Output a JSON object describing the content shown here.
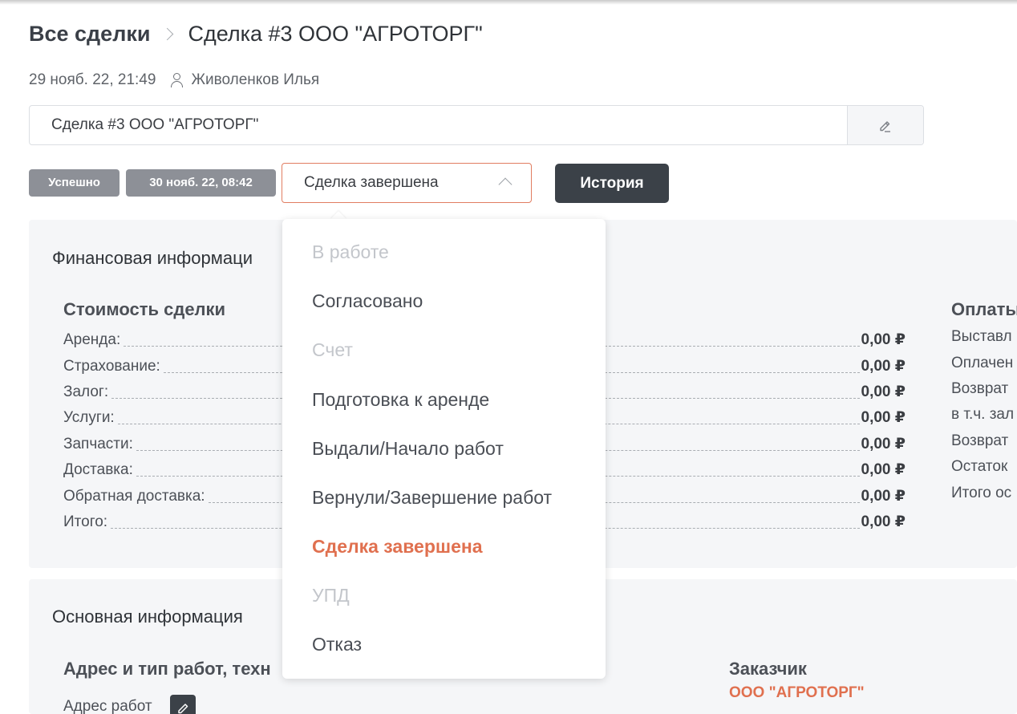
{
  "breadcrumb": {
    "root": "Все сделки",
    "current": "Сделка #3 ООО \"АГРОТОРГ\""
  },
  "meta": {
    "datetime": "29 нояб. 22, 21:49",
    "author": "Живоленков Илья"
  },
  "title_input": {
    "value": "Сделка #3 ООО \"АГРОТОРГ\""
  },
  "badges": {
    "status": "Успешно",
    "date": "30 нояб. 22, 08:42"
  },
  "status_select": {
    "value": "Сделка завершена"
  },
  "history_button": "История",
  "financial": {
    "title": "Финансовая информаци",
    "cost": {
      "heading": "Стоимость сделки",
      "rows": [
        {
          "label": "Аренда:",
          "value": "0,00 ₽"
        },
        {
          "label": "Страхование:",
          "value": "0,00 ₽"
        },
        {
          "label": "Залог:",
          "value": "0,00 ₽"
        },
        {
          "label": "Услуги:",
          "value": "0,00 ₽"
        },
        {
          "label": "Запчасти:",
          "value": "0,00 ₽"
        },
        {
          "label": "Доставка:",
          "value": "0,00 ₽"
        },
        {
          "label": "Обратная доставка:",
          "value": "0,00 ₽"
        },
        {
          "label": "Итого:",
          "value": "0,00 ₽"
        }
      ]
    },
    "payments": {
      "heading": "Оплаты",
      "rows": [
        "Выставл",
        "Оплачен",
        "Возврат",
        "в т.ч. зал",
        "Возврат",
        "Остаток",
        "Итого ос"
      ]
    }
  },
  "main_info": {
    "title": "Основная информация",
    "address_heading": "Адрес и тип работ, техн",
    "address_label": "Адрес работ",
    "customer_heading": "Заказчик",
    "customer_name": "ООО \"АГРОТОРГ\""
  },
  "dropdown": {
    "items": [
      {
        "label": "В работе",
        "state": "disabled"
      },
      {
        "label": "Согласовано",
        "state": "normal"
      },
      {
        "label": "Счет",
        "state": "disabled"
      },
      {
        "label": "Подготовка к аренде",
        "state": "normal"
      },
      {
        "label": "Выдали/Начало работ",
        "state": "normal"
      },
      {
        "label": "Вернули/Завершение работ",
        "state": "normal"
      },
      {
        "label": "Сделка завершена",
        "state": "active"
      },
      {
        "label": "УПД",
        "state": "disabled"
      },
      {
        "label": "Отказ",
        "state": "normal"
      }
    ]
  },
  "colors": {
    "accent": "#e0704f",
    "dark_button": "#3b4148",
    "badge": "#8d9097",
    "panel": "#f5f6f8"
  },
  "icons": {
    "breadcrumb_separator": "chevron-right-icon",
    "user": "user-icon",
    "edit": "pencil-icon",
    "select": "chevron-up-icon"
  }
}
